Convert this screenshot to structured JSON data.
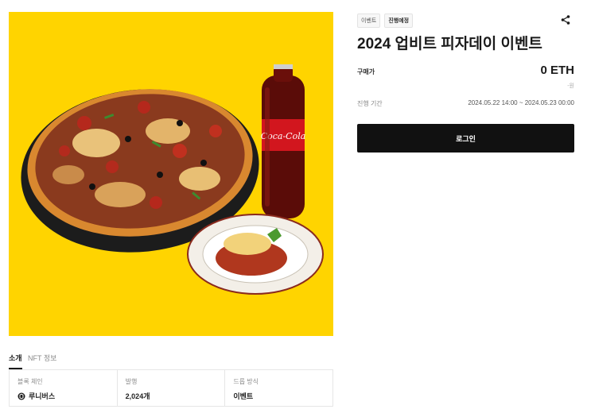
{
  "event": {
    "badges": [
      "이벤트",
      "진행예정"
    ],
    "title": "2024 업비트 피자데이 이벤트"
  },
  "price": {
    "label": "구매가",
    "value": "0 ETH",
    "krw": "-원"
  },
  "period": {
    "label": "진행 기간",
    "value": "2024.05.22 14:00 ~ 2024.05.23 00:00"
  },
  "actions": {
    "login_label": "로그인"
  },
  "tabs": [
    "소개",
    "NFT 정보"
  ],
  "info": {
    "chain_label": "블록 체인",
    "chain_value": "루니버스",
    "issued_label": "발행",
    "issued_value": "2,024개",
    "drop_label": "드롭 방식",
    "drop_value": "이벤트"
  },
  "colors": {
    "hero_bg": "#ffd400",
    "button_bg": "#111111"
  }
}
